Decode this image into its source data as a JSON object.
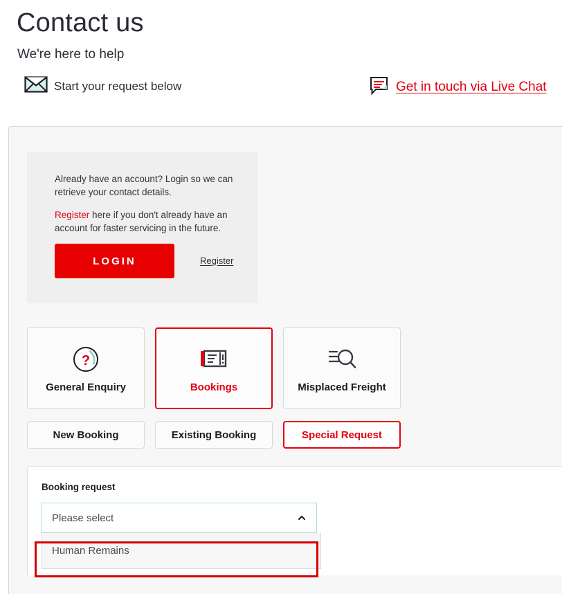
{
  "header": {
    "title": "Contact us",
    "subtitle": "We're here to help",
    "start_label": "Start your request below",
    "start_icon": "envelope-icon",
    "chat_label": "Get in touch via Live Chat",
    "chat_icon": "chat-bubble-icon"
  },
  "login_box": {
    "paragraph1": "Already have an account? Login so we can retrieve your contact details.",
    "paragraph2_link": "Register",
    "paragraph2_rest": " here if you don't already have an account for faster servicing in the future.",
    "login_label": "LOGIN",
    "register_link": "Register"
  },
  "categories": [
    {
      "label": "General Enquiry",
      "icon": "question-circle-icon",
      "active": false
    },
    {
      "label": "Bookings",
      "icon": "ticket-card-icon",
      "active": true
    },
    {
      "label": "Misplaced Freight",
      "icon": "search-list-icon",
      "active": false
    }
  ],
  "tabs": [
    {
      "label": "New Booking",
      "active": false
    },
    {
      "label": "Existing Booking",
      "active": false
    },
    {
      "label": "Special Request",
      "active": true
    }
  ],
  "form": {
    "field_label": "Booking request",
    "select_value": "Please select",
    "select_placeholder": "Please select",
    "caret_icon": "chevron-up-icon",
    "dropdown_options": [
      "Human Remains"
    ]
  },
  "colors": {
    "brand_red": "#e3000f",
    "button_red": "#e60000",
    "annotation_red": "#d40000",
    "teal_accent": "#a5ded6",
    "heading": "#2b2b35"
  }
}
